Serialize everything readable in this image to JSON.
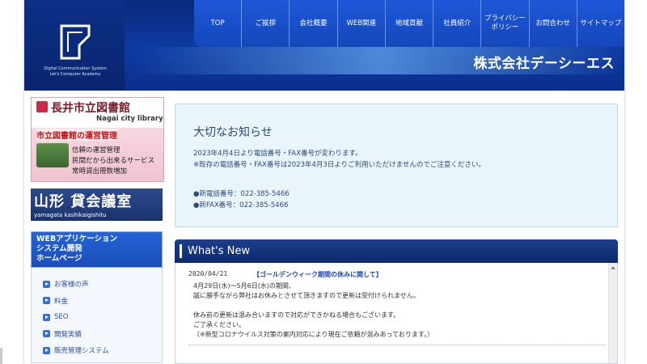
{
  "header": {
    "logo_text": [
      "Digital Communication System",
      "Let's Computer Academy"
    ],
    "company_name": "株式会社デーシーエス",
    "nav": [
      "TOP",
      "ご挨拶",
      "会社概要",
      "WEB関連",
      "地域貢献",
      "社員紹介",
      "プライバシー ポリシー",
      "お問合わせ",
      "サイトマップ"
    ]
  },
  "sidebar": {
    "library": {
      "title": "長井市立図書館",
      "subtitle": "Nagai city library",
      "headline": "市立図書館の運営管理",
      "lines": [
        "信頼の運営管理",
        "民間だから出来るサービス",
        "常時貸出冊数増加"
      ]
    },
    "yamagata": {
      "title": "山形 貸会議室",
      "subtitle": "yamagata kashikaigishitu"
    },
    "blue_box": [
      "WEBアプリケーション",
      "システム開発",
      "ホームページ"
    ],
    "menu": [
      "お客様の声",
      "料金",
      "SEO",
      "開発実績",
      "販売管理システム"
    ]
  },
  "notice": {
    "title": "大切なお知らせ",
    "line1": "2023年4月4日より電話番号・FAX番号が変わります。",
    "line2": "※既存の電話番号・FAX番号は2023年4月3日よりご利用いただけませんのでご注意ください。",
    "tel": "●新電話番号：022-385-5466",
    "fax": "●新FAX番号：022-385-5466"
  },
  "news": {
    "heading": "What's New",
    "date": "2020/04/21",
    "title": "【ゴールデンウィーク期間の休みに関して】",
    "body": [
      "4月29日(水)～5月6日(水)の期間、",
      "誠に勝手ながら弊社はお休みとさせて頂きますので更新は受付けられません。",
      "",
      "休み前の更新は混み合いますので対応ができかねる場合もございます。",
      "ご了承ください。",
      "（※新型コロナウイルス対策の案内対応により現在ご依頼が混みあっております。）"
    ]
  },
  "colors": {
    "header_blue": "#0d3aa3",
    "nav_blue": "#1d57d8",
    "notice_bg": "#eaf5fb",
    "news_title": "#1a44b0"
  }
}
